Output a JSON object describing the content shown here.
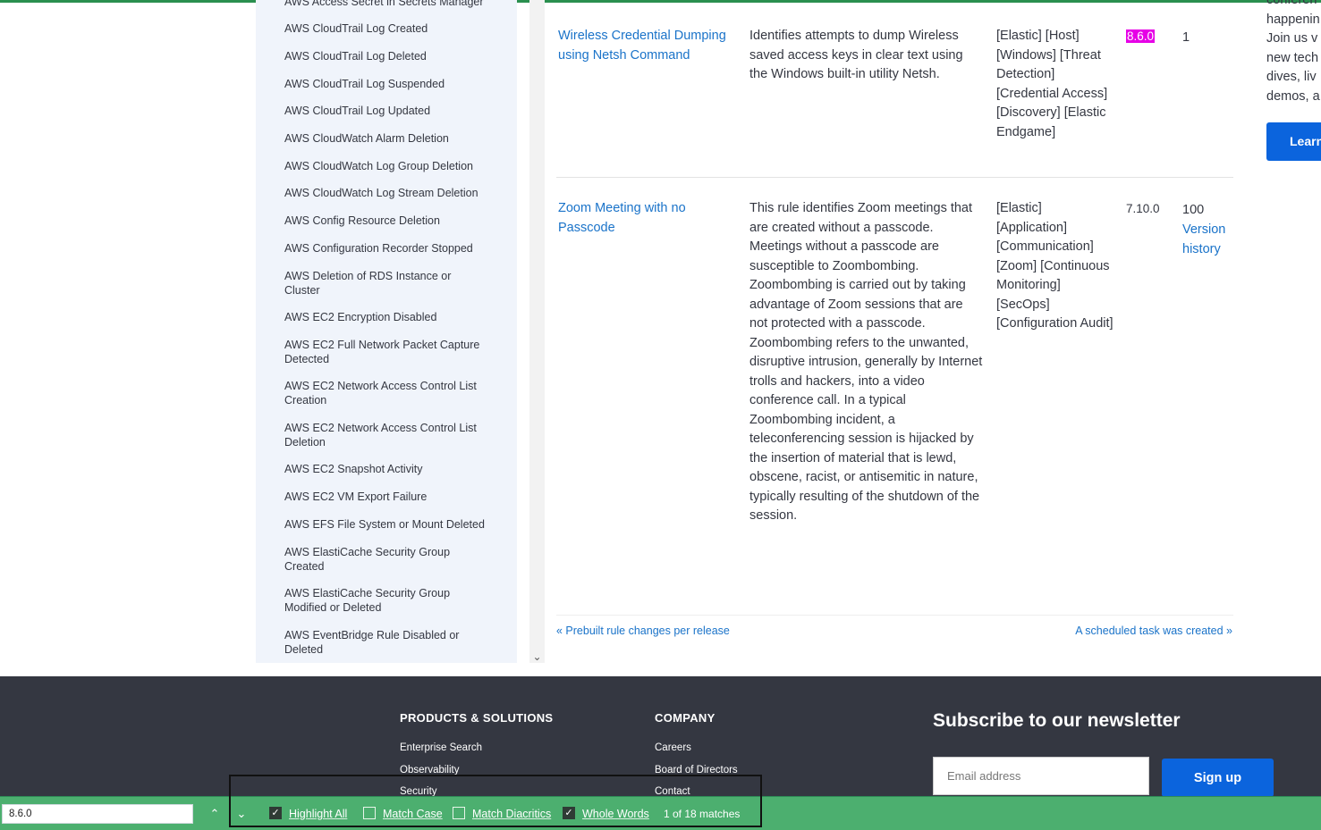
{
  "sidebar": {
    "items": [
      "AWS Access Secret in Secrets Manager",
      "AWS CloudTrail Log Created",
      "AWS CloudTrail Log Deleted",
      "AWS CloudTrail Log Suspended",
      "AWS CloudTrail Log Updated",
      "AWS CloudWatch Alarm Deletion",
      "AWS CloudWatch Log Group Deletion",
      "AWS CloudWatch Log Stream Deletion",
      "AWS Config Resource Deletion",
      "AWS Configuration Recorder Stopped",
      "AWS Deletion of RDS Instance or Cluster",
      "AWS EC2 Encryption Disabled",
      "AWS EC2 Full Network Packet Capture Detected",
      "AWS EC2 Network Access Control List Creation",
      "AWS EC2 Network Access Control List Deletion",
      "AWS EC2 Snapshot Activity",
      "AWS EC2 VM Export Failure",
      "AWS EFS File System or Mount Deleted",
      "AWS ElastiCache Security Group Created",
      "AWS ElastiCache Security Group Modified or Deleted",
      "AWS EventBridge Rule Disabled or Deleted"
    ]
  },
  "rules": [
    {
      "name": "Wireless Credential Dumping using Netsh Command",
      "description": "Identifies attempts to dump Wireless saved access keys in clear text using the Windows built-in utility Netsh.",
      "tags": "[Elastic] [Host] [Windows] [Threat Detection] [Credential Access] [Discovery] [Elastic Endgame]",
      "version_added": "8.6.0",
      "version": "1"
    },
    {
      "name": "Zoom Meeting with no Passcode",
      "description": "This rule identifies Zoom meetings that are created without a passcode. Meetings without a passcode are susceptible to Zoombombing. Zoombombing is carried out by taking advantage of Zoom sessions that are not protected with a passcode. Zoombombing refers to the unwanted, disruptive intrusion, generally by Internet trolls and hackers, into a video conference call. In a typical Zoombombing incident, a teleconferencing session is hijacked by the insertion of material that is lewd, obscene, racist, or antisemitic in nature, typically resulting of the shutdown of the session.",
      "tags": "[Elastic] [Application] [Communication] [Zoom] [Continuous Monitoring] [SecOps] [Configuration Audit]",
      "version_added": "7.10.0",
      "version": "100",
      "history_link": "Version history"
    }
  ],
  "nav": {
    "prev": "« Prebuilt rule changes per release",
    "next": "A scheduled task was created »"
  },
  "promo": {
    "lines": [
      "conferen",
      "happenin",
      "Join us v",
      "new tech",
      "dives, liv",
      "demos, a"
    ],
    "button": "Learn"
  },
  "footer": {
    "products_heading": "PRODUCTS & SOLUTIONS",
    "products_links": [
      "Enterprise Search",
      "Observability",
      "Security"
    ],
    "company_heading": "COMPANY",
    "company_links": [
      "Careers",
      "Board of Directors",
      "Contact"
    ],
    "newsletter_title": "Subscribe to our newsletter",
    "email_placeholder": "Email address",
    "signup_label": "Sign up"
  },
  "findbar": {
    "query": "8.6.0",
    "options": [
      {
        "label": "Highlight All",
        "checked": true
      },
      {
        "label": "Match Case",
        "checked": false
      },
      {
        "label": "Match Diacritics",
        "checked": false
      },
      {
        "label": "Whole Words",
        "checked": true
      }
    ],
    "match_count": "1 of 18 matches"
  },
  "colors": {
    "findbar_bg": "#4caf6f",
    "highlight": "#e600e6",
    "link": "#1a73c9",
    "footer_bg": "#343741",
    "button_blue": "#0b64dd"
  }
}
